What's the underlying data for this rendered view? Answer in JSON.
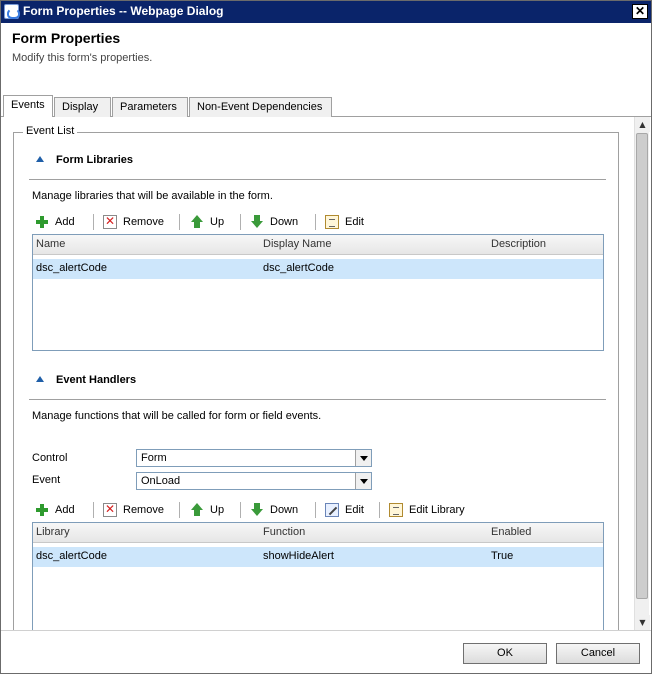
{
  "window": {
    "title": "Form Properties -- Webpage Dialog",
    "close_label": "✕"
  },
  "header": {
    "title": "Form Properties",
    "subtitle": "Modify this form's properties."
  },
  "tabs": [
    {
      "label": "Events",
      "active": true
    },
    {
      "label": "Display",
      "active": false
    },
    {
      "label": "Parameters",
      "active": false
    },
    {
      "label": "Non-Event Dependencies",
      "active": false
    }
  ],
  "event_list": {
    "legend": "Event List"
  },
  "form_libraries": {
    "title": "Form Libraries",
    "description": "Manage libraries that will be available in the form.",
    "toolbar": {
      "add": "Add",
      "remove": "Remove",
      "up": "Up",
      "down": "Down",
      "edit": "Edit"
    },
    "columns": [
      "Name",
      "Display Name",
      "Description"
    ],
    "rows": [
      {
        "name": "dsc_alertCode",
        "display_name": "dsc_alertCode",
        "description": ""
      }
    ]
  },
  "event_handlers": {
    "title": "Event Handlers",
    "description": "Manage functions that will be called for form or field events.",
    "control_label": "Control",
    "control_value": "Form",
    "event_label": "Event",
    "event_value": "OnLoad",
    "toolbar": {
      "add": "Add",
      "remove": "Remove",
      "up": "Up",
      "down": "Down",
      "edit": "Edit",
      "edit_library": "Edit Library"
    },
    "columns": [
      "Library",
      "Function",
      "Enabled"
    ],
    "rows": [
      {
        "library": "dsc_alertCode",
        "function": "showHideAlert",
        "enabled": "True"
      }
    ]
  },
  "footer": {
    "ok": "OK",
    "cancel": "Cancel"
  }
}
